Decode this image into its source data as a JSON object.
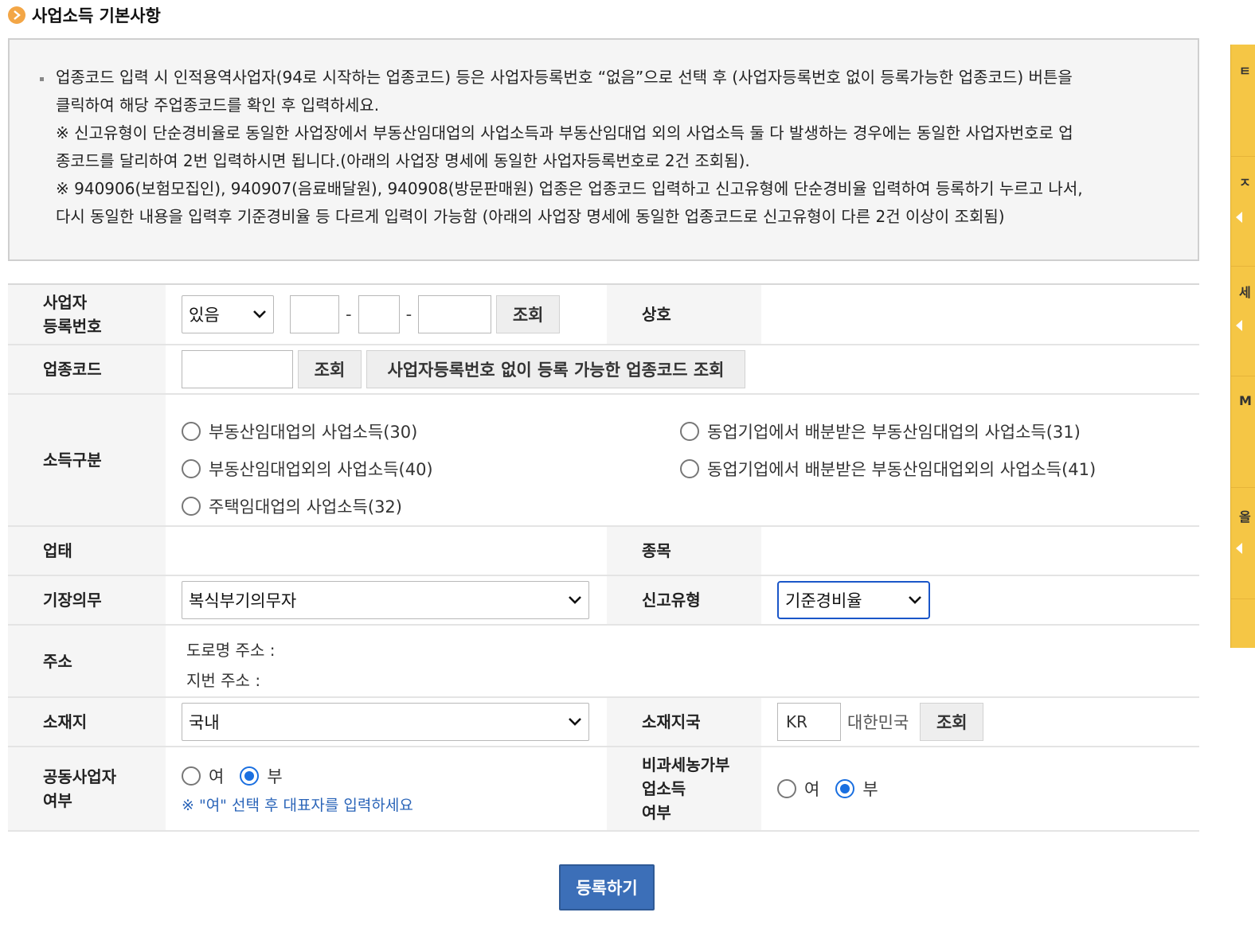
{
  "section": {
    "title": "사업소득 기본사항"
  },
  "notice": {
    "lines": [
      "업종코드 입력 시 인적용역사업자(94로 시작하는 업종코드) 등은 사업자등록번호 “없음”으로 선택 후 (사업자등록번호 없이 등록가능한 업종코드) 버튼을",
      "클릭하여 해당 주업종코드를 확인 후 입력하세요.",
      "※ 신고유형이 단순경비율로 동일한 사업장에서 부동산임대업의 사업소득과 부동산임대업 외의 사업소득 둘 다 발생하는 경우에는 동일한 사업자번호로 업",
      "종코드를 달리하여 2번 입력하시면 됩니다.(아래의 사업장 명세에 동일한 사업자등록번호로 2건 조회됨).",
      "※ 940906(보험모집인), 940907(음료배달원), 940908(방문판매원) 업종은 업종코드 입력하고 신고유형에 단순경비율 입력하여 등록하기 누르고 나서,",
      "다시 동일한 내용을 입력후 기준경비율 등 다르게 입력이 가능함 (아래의 사업장 명세에 동일한 업종코드로 신고유형이 다른 2건 이상이 조회됨)"
    ]
  },
  "form": {
    "bizno": {
      "label_1": "사업자",
      "label_2": "등록번호",
      "select_value": "있음",
      "lookup": "조회"
    },
    "trade_name": {
      "label": "상호"
    },
    "industry_code": {
      "label": "업종코드",
      "lookup": "조회",
      "no_bizno_lookup": "사업자등록번호 없이 등록 가능한 업종코드 조회"
    },
    "income_type": {
      "label": "소득구분",
      "options": [
        "부동산임대업의 사업소득(30)",
        "동업기업에서 배분받은 부동산임대업의 사업소득(31)",
        "부동산임대업외의 사업소득(40)",
        "동업기업에서 배분받은 부동산임대업외의 사업소득(41)",
        "주택임대업의 사업소득(32)"
      ]
    },
    "business_type": {
      "label": "업태"
    },
    "item": {
      "label": "종목"
    },
    "bookkeeping": {
      "label": "기장의무",
      "value": "복식부기의무자"
    },
    "report_type": {
      "label": "신고유형",
      "value": "기준경비율"
    },
    "address": {
      "label": "주소",
      "road": "도로명 주소 :",
      "lot": "지번 주소 :"
    },
    "location": {
      "label": "소재지",
      "value": "국내"
    },
    "country": {
      "label": "소재지국",
      "code": "KR",
      "name": "대한민국",
      "lookup": "조회"
    },
    "joint": {
      "label_1": "공동사업자",
      "label_2": "여부",
      "yes": "여",
      "no": "부",
      "selected": "부",
      "note": "※ \"여\" 선택 후 대표자를 입력하세요"
    },
    "nontax_farm": {
      "label_1": "비과세농가부",
      "label_2": "업소득",
      "label_3": "여부",
      "yes": "여",
      "no": "부",
      "selected": "부"
    }
  },
  "submit": {
    "label": "등록하기"
  },
  "side": {
    "chars": [
      "ㅌ",
      "ㅈ",
      "세",
      "M",
      "올"
    ]
  },
  "colors": {
    "accent": "#3c6fb8",
    "radio_on": "#1a6fe0",
    "side_panel": "#f5c645",
    "title_icon": "#f3a646",
    "note_blue": "#2a64b8"
  }
}
